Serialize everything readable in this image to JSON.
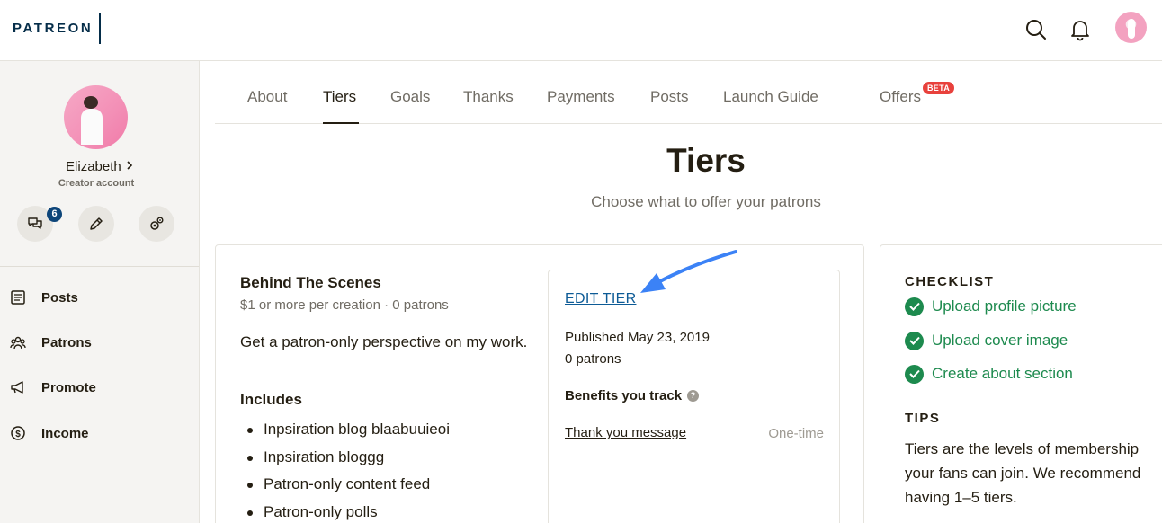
{
  "header": {
    "logo": "PATREON",
    "search_icon": "search-icon",
    "notification_icon": "bell-icon",
    "avatar_icon": "user-avatar"
  },
  "sidebar": {
    "user_name": "Elizabeth",
    "user_role": "Creator account",
    "message_badge": "6",
    "actions": [
      "chat-icon",
      "pencil-icon",
      "settings-icon"
    ],
    "items": [
      {
        "label": "Posts",
        "icon": "posts-icon"
      },
      {
        "label": "Patrons",
        "icon": "patrons-icon"
      },
      {
        "label": "Promote",
        "icon": "megaphone-icon"
      },
      {
        "label": "Income",
        "icon": "dollar-icon"
      }
    ]
  },
  "tabs": {
    "items": [
      "About",
      "Tiers",
      "Goals",
      "Thanks",
      "Payments",
      "Posts",
      "Launch Guide",
      "Offers"
    ],
    "active": "Tiers",
    "beta_label": "BETA"
  },
  "page": {
    "title": "Tiers",
    "subtitle": "Choose what to offer your patrons"
  },
  "tier": {
    "name": "Behind The Scenes",
    "price_meta": "$1 or more per creation",
    "patron_meta": "0 patrons",
    "description": "Get a patron-only perspective on my work.",
    "includes_label": "Includes",
    "benefits": [
      "Inpsiration blog blaabuuieoi",
      "Inpsiration bloggg",
      "Patron-only content feed",
      "Patron-only polls"
    ],
    "edit_label": "EDIT TIER",
    "published": "Published May 23, 2019",
    "patrons": "0 patrons",
    "benefits_track_label": "Benefits you track",
    "tracked_benefit": "Thank you message",
    "tracked_frequency": "One-time"
  },
  "checklist": {
    "title": "CHECKLIST",
    "items": [
      "Upload profile picture",
      "Upload cover image",
      "Create about section"
    ],
    "tips_title": "TIPS",
    "tips_text": "Tiers are the levels of membership your fans can join. We recommend having 1–5 tiers."
  },
  "colors": {
    "brand_navy": "#052d49",
    "link_blue": "#0d5b96",
    "check_green": "#1d8a4e",
    "beta_red": "#e8413c",
    "arrow_blue": "#3b82f6"
  }
}
